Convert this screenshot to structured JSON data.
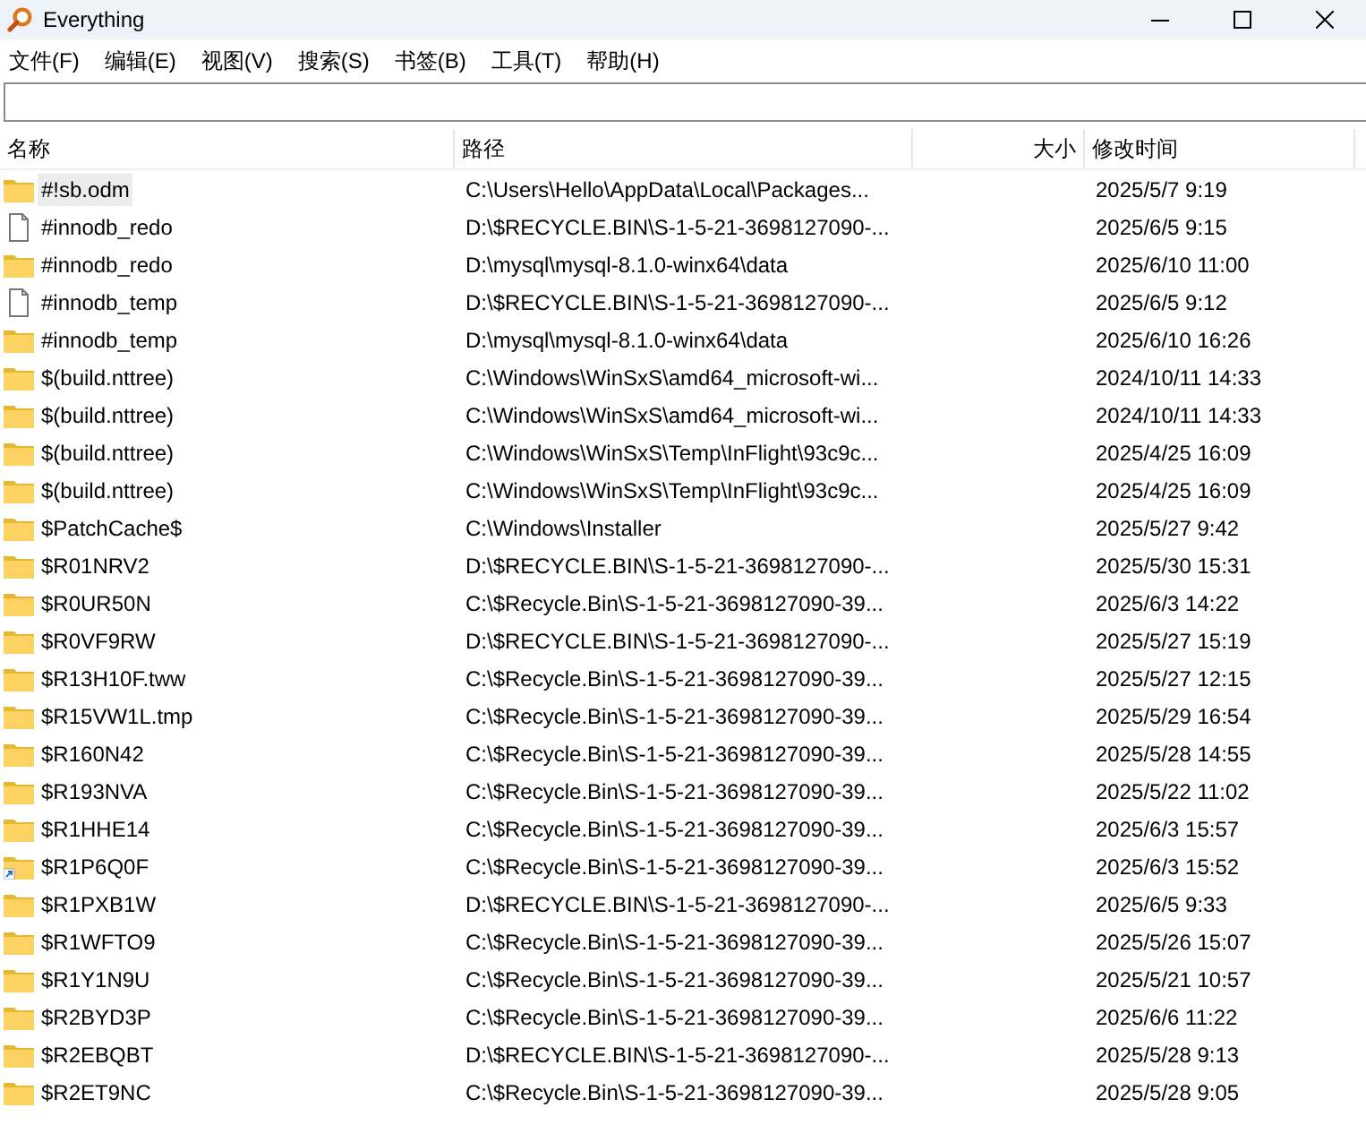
{
  "window": {
    "title": "Everything"
  },
  "menu": [
    "文件(F)",
    "编辑(E)",
    "视图(V)",
    "搜索(S)",
    "书签(B)",
    "工具(T)",
    "帮助(H)"
  ],
  "table": {
    "columns": [
      "名称",
      "路径",
      "大小",
      "修改时间"
    ],
    "rows": [
      {
        "kind": "folder",
        "selected": true,
        "name": "#!sb.odm",
        "path": "C:\\Users\\Hello\\AppData\\Local\\Packages...",
        "modified": "2025/5/7 9:19"
      },
      {
        "kind": "file",
        "selected": false,
        "name": "#innodb_redo",
        "path": "D:\\$RECYCLE.BIN\\S-1-5-21-3698127090-...",
        "modified": "2025/6/5 9:15"
      },
      {
        "kind": "folder",
        "selected": false,
        "name": "#innodb_redo",
        "path": "D:\\mysql\\mysql-8.1.0-winx64\\data",
        "modified": "2025/6/10 11:00"
      },
      {
        "kind": "file",
        "selected": false,
        "name": "#innodb_temp",
        "path": "D:\\$RECYCLE.BIN\\S-1-5-21-3698127090-...",
        "modified": "2025/6/5 9:12"
      },
      {
        "kind": "folder",
        "selected": false,
        "name": "#innodb_temp",
        "path": "D:\\mysql\\mysql-8.1.0-winx64\\data",
        "modified": "2025/6/10 16:26"
      },
      {
        "kind": "folder",
        "selected": false,
        "name": "$(build.nttree)",
        "path": "C:\\Windows\\WinSxS\\amd64_microsoft-wi...",
        "modified": "2024/10/11 14:33"
      },
      {
        "kind": "folder",
        "selected": false,
        "name": "$(build.nttree)",
        "path": "C:\\Windows\\WinSxS\\amd64_microsoft-wi...",
        "modified": "2024/10/11 14:33"
      },
      {
        "kind": "folder",
        "selected": false,
        "name": "$(build.nttree)",
        "path": "C:\\Windows\\WinSxS\\Temp\\InFlight\\93c9c...",
        "modified": "2025/4/25 16:09"
      },
      {
        "kind": "folder",
        "selected": false,
        "name": "$(build.nttree)",
        "path": "C:\\Windows\\WinSxS\\Temp\\InFlight\\93c9c...",
        "modified": "2025/4/25 16:09"
      },
      {
        "kind": "folder",
        "selected": false,
        "name": "$PatchCache$",
        "path": "C:\\Windows\\Installer",
        "modified": "2025/5/27 9:42"
      },
      {
        "kind": "folder",
        "selected": false,
        "name": "$R01NRV2",
        "path": "D:\\$RECYCLE.BIN\\S-1-5-21-3698127090-...",
        "modified": "2025/5/30 15:31"
      },
      {
        "kind": "folder",
        "selected": false,
        "name": "$R0UR50N",
        "path": "C:\\$Recycle.Bin\\S-1-5-21-3698127090-39...",
        "modified": "2025/6/3 14:22"
      },
      {
        "kind": "folder",
        "selected": false,
        "name": "$R0VF9RW",
        "path": "D:\\$RECYCLE.BIN\\S-1-5-21-3698127090-...",
        "modified": "2025/5/27 15:19"
      },
      {
        "kind": "folder",
        "selected": false,
        "name": "$R13H10F.tww",
        "path": "C:\\$Recycle.Bin\\S-1-5-21-3698127090-39...",
        "modified": "2025/5/27 12:15"
      },
      {
        "kind": "folder",
        "selected": false,
        "name": "$R15VW1L.tmp",
        "path": "C:\\$Recycle.Bin\\S-1-5-21-3698127090-39...",
        "modified": "2025/5/29 16:54"
      },
      {
        "kind": "folder",
        "selected": false,
        "name": "$R160N42",
        "path": "C:\\$Recycle.Bin\\S-1-5-21-3698127090-39...",
        "modified": "2025/5/28 14:55"
      },
      {
        "kind": "folder",
        "selected": false,
        "name": "$R193NVA",
        "path": "C:\\$Recycle.Bin\\S-1-5-21-3698127090-39...",
        "modified": "2025/5/22 11:02"
      },
      {
        "kind": "folder",
        "selected": false,
        "name": "$R1HHE14",
        "path": "C:\\$Recycle.Bin\\S-1-5-21-3698127090-39...",
        "modified": "2025/6/3 15:57"
      },
      {
        "kind": "shortcut",
        "selected": false,
        "name": "$R1P6Q0F",
        "path": "C:\\$Recycle.Bin\\S-1-5-21-3698127090-39...",
        "modified": "2025/6/3 15:52"
      },
      {
        "kind": "folder",
        "selected": false,
        "name": "$R1PXB1W",
        "path": "D:\\$RECYCLE.BIN\\S-1-5-21-3698127090-...",
        "modified": "2025/6/5 9:33"
      },
      {
        "kind": "folder",
        "selected": false,
        "name": "$R1WFTO9",
        "path": "C:\\$Recycle.Bin\\S-1-5-21-3698127090-39...",
        "modified": "2025/5/26 15:07"
      },
      {
        "kind": "folder",
        "selected": false,
        "name": "$R1Y1N9U",
        "path": "C:\\$Recycle.Bin\\S-1-5-21-3698127090-39...",
        "modified": "2025/5/21 10:57"
      },
      {
        "kind": "folder",
        "selected": false,
        "name": "$R2BYD3P",
        "path": "C:\\$Recycle.Bin\\S-1-5-21-3698127090-39...",
        "modified": "2025/6/6 11:22"
      },
      {
        "kind": "folder",
        "selected": false,
        "name": "$R2EBQBT",
        "path": "D:\\$RECYCLE.BIN\\S-1-5-21-3698127090-...",
        "modified": "2025/5/28 9:13"
      },
      {
        "kind": "folder",
        "selected": false,
        "name": "$R2ET9NC",
        "path": "C:\\$Recycle.Bin\\S-1-5-21-3698127090-39...",
        "modified": "2025/5/28 9:05"
      }
    ]
  }
}
